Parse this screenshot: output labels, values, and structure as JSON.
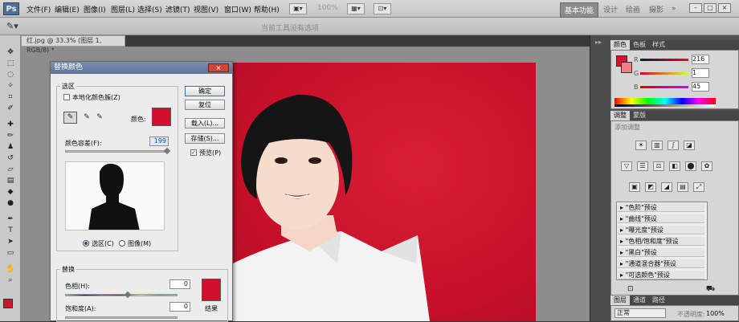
{
  "app_logo": "Ps",
  "menu": [
    "文件(F)",
    "编辑(E)",
    "图像(I)",
    "图层(L)",
    "选择(S)",
    "滤镜(T)",
    "视图(V)",
    "窗口(W)",
    "帮助(H)"
  ],
  "zoom_value": "100%",
  "workspaces": {
    "active": "基本功能",
    "items": [
      "设计",
      "绘画",
      "摄影"
    ]
  },
  "window_buttons": [
    "–",
    "□",
    "×"
  ],
  "options_message": "当前工具没有选项",
  "document_tab": "红.jpg @ 33.3% (图层 1, RGB/8) *",
  "dialog": {
    "title": "替换颜色",
    "close": "×",
    "selection_group": "选区",
    "localized_clusters": "本地化颜色簇(Z)",
    "color_label": "颜色:",
    "fuzziness_label": "颜色容差(F):",
    "fuzziness_value": "199",
    "radio_selection": "选区(C)",
    "radio_image": "图像(M)",
    "buttons": {
      "ok": "确定",
      "reset": "复位",
      "load": "载入(L)...",
      "save": "存储(S)..."
    },
    "preview": "预览(P)",
    "replace_group": "替换",
    "hue_label": "色相(H):",
    "hue_value": "0",
    "saturation_label": "饱和度(A):",
    "saturation_value": "0",
    "result_label": "结果",
    "selection_color": "#d40f2d",
    "result_color": "#d40f2d"
  },
  "color_panel": {
    "tabs": [
      "颜色",
      "色板",
      "样式"
    ],
    "r_label": "R",
    "r_value": "216",
    "g_label": "G",
    "g_value": "1",
    "b_label": "B",
    "b_value": "45",
    "foreground": "#d80f2d"
  },
  "adjust_panel": {
    "tabs": [
      "调整",
      "蒙版"
    ],
    "title": "添加调整",
    "presets": [
      "\"色阶\"预设",
      "\"曲线\"预设",
      "\"曝光度\"预设",
      "\"色相/饱和度\"预设",
      "\"黑白\"预设",
      "\"通道混合器\"预设",
      "\"可选颜色\"预设"
    ]
  },
  "layers_panel": {
    "tabs": [
      "图层",
      "通道",
      "路径"
    ],
    "blend_mode": "正常",
    "opacity_label": "不透明度:",
    "opacity_value": "100%"
  }
}
